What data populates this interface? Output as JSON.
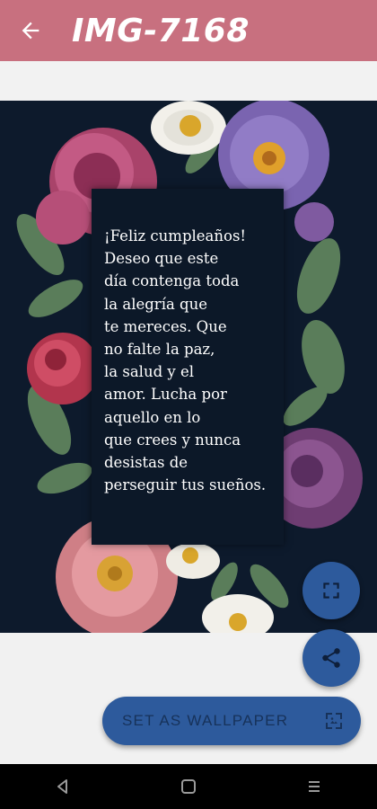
{
  "app_bar": {
    "title": "IMG-7168",
    "back_icon": "arrow-left-icon",
    "background": "#c8707f"
  },
  "card": {
    "background": "#0d1a2c",
    "message": "¡Feliz cumpleaños!\nDeseo que este\ndía contenga toda\nla alegría que\nte mereces. Que\nno falte la paz,\nla salud y el\namor. Lucha por\naquello en lo\nque crees y nunca\ndesistas de\nperseguir tus sueños."
  },
  "actions": {
    "fullscreen_icon": "fullscreen-icon",
    "share_icon": "share-icon",
    "set_wallpaper_label": "SET AS WALLPAPER",
    "set_wallpaper_icon": "wallpaper-icon",
    "accent": "#2d5a9c"
  },
  "system_nav": {
    "back_icon": "nav-back-icon",
    "home_icon": "nav-home-icon",
    "recents_icon": "nav-recents-icon"
  }
}
